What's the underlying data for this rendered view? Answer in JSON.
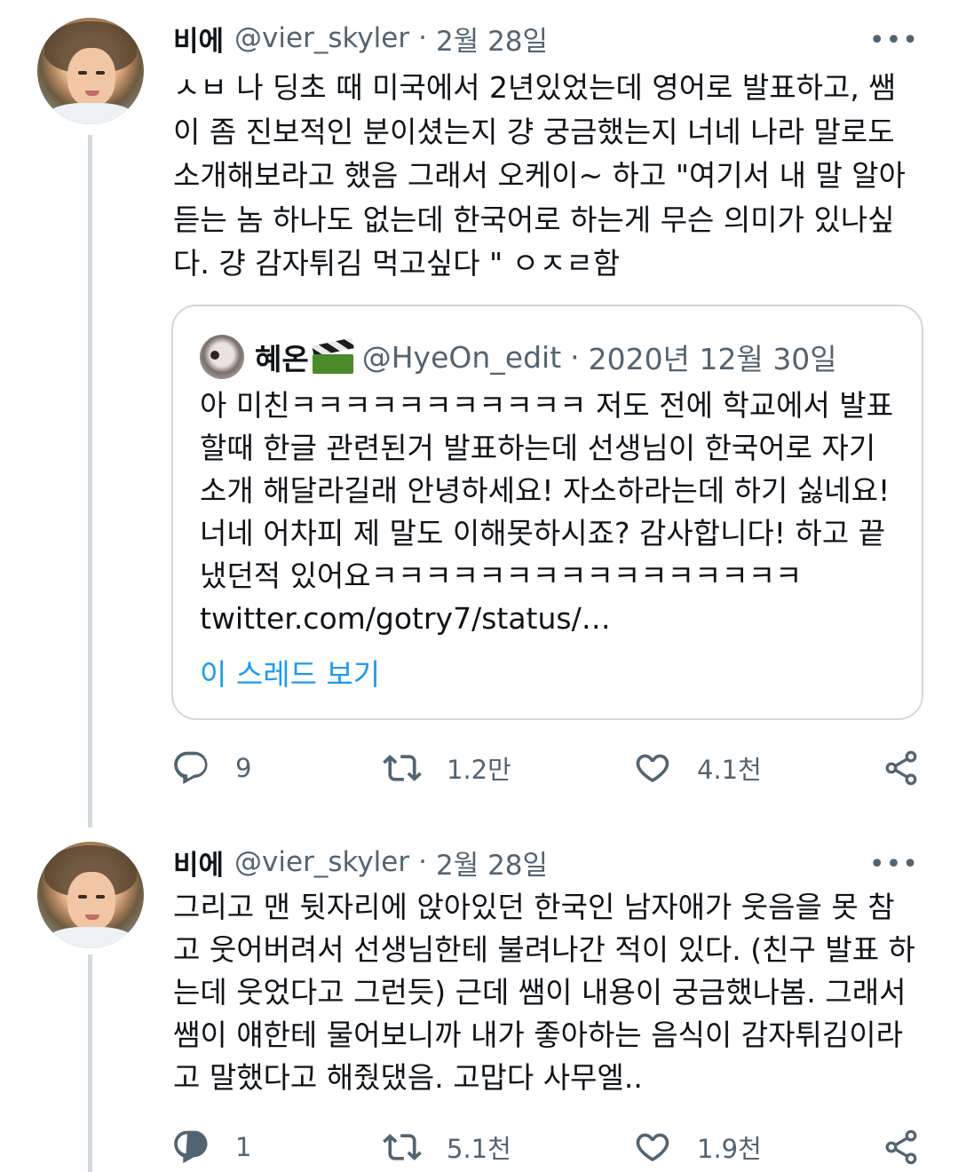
{
  "tweets": [
    {
      "author_name": "비에",
      "handle": "@vier_skyler",
      "separator": "·",
      "date": "2월 28일",
      "more": "•••",
      "text": "ㅅㅂ 나 딩초 때 미국에서 2년있었는데 영어로 발표하고, 쌤이 좀 진보적인 분이셨는지 걍 궁금했는지 너네 나라 말로도  소개해보라고 했음 그래서 오케이~ 하고 \"여기서 내 말 알아듣는 놈 하나도 없는데 한국어로 하는게 무슨 의미가 있나싶다. 걍 감자튀김 먹고싶다 \" ㅇㅈㄹ함",
      "quote": {
        "author_name": "혜온",
        "handle": "@HyeOn_edit",
        "separator": "·",
        "date": "2020년 12월 30일",
        "text": "아 미친ㅋㅋㅋㅋㅋㅋㅋㅋㅋㅋㅋ 저도 전에 학교에서 발표할때 한글 관련된거 발표하는데 선생님이 한국어로 자기소개 해달라길래 안녕하세요! 자소하라는데 하기 싫네요! 너네 어차피 제 말도 이해못하시죠? 감사합니다! 하고 끝냈던적 있어요ㅋㅋㅋㅋㅋㅋㅋㅋㅋㅋㅋㅋㅋㅋㅋㅋ twitter.com/gotry7/status/…",
        "show_thread": "이 스레드 보기"
      },
      "stats": {
        "replies": "9",
        "retweets": "1.2만",
        "likes": "4.1천"
      }
    },
    {
      "author_name": "비에",
      "handle": "@vier_skyler",
      "separator": "·",
      "date": "2월 28일",
      "more": "•••",
      "text": "그리고 맨 뒷자리에 앉아있던 한국인 남자애가 웃음을 못 참고 웃어버려서 선생님한테 불려나간 적이 있다. (친구 발표 하는데 웃었다고 그런듯) 근데 쌤이 내용이 궁금했나봄. 그래서 쌤이 얘한테 물어보니까 내가 좋아하는 음식이 감자튀김이라고 말했다고 해줬댔음.  고맙다 사무엘..",
      "stats": {
        "replies": "1",
        "retweets": "5.1천",
        "likes": "1.9천"
      }
    }
  ],
  "colors": {
    "text": "#0f1419",
    "secondary": "#536471",
    "link": "#1d9bf0",
    "border": "#cfd9de"
  },
  "icons": {
    "reply": "reply-icon",
    "retweet": "retweet-icon",
    "like": "like-icon",
    "share": "share-icon"
  }
}
